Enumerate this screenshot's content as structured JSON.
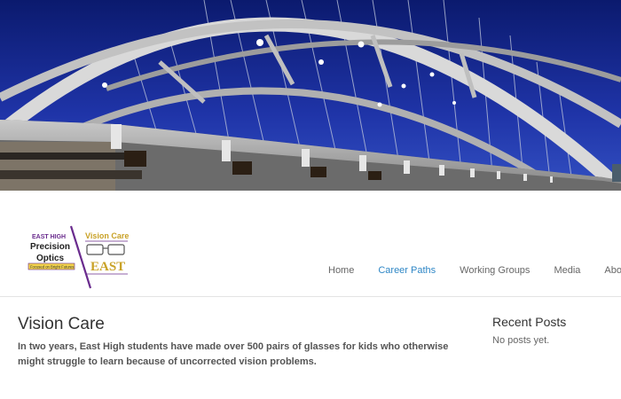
{
  "hero": {
    "image": "illuminated-arch-bridge-night-sky"
  },
  "logo": {
    "left_line1": "EAST HIGH",
    "left_line2": "Precision",
    "left_line3": "Optics",
    "tagline": "Focused on Bright Futures",
    "right_line1": "Vision Care",
    "right_line2": "EAST"
  },
  "nav": {
    "items": [
      {
        "label": "Home",
        "active": false
      },
      {
        "label": "Career Paths",
        "active": true
      },
      {
        "label": "Working Groups",
        "active": false
      },
      {
        "label": "Media",
        "active": false
      },
      {
        "label": "About ST",
        "active": false
      }
    ]
  },
  "main": {
    "title": "Vision Care",
    "intro": "In two years, East High students have made over 500 pairs of glasses for kids who otherwise might struggle to learn because of uncorrected vision problems."
  },
  "sidebar": {
    "title": "Recent Posts",
    "empty": "No posts yet."
  },
  "colors": {
    "accent": "#2f87c6",
    "logo_purple": "#6a2c8e",
    "logo_gold": "#c9a227",
    "sky": "#1d2a8c"
  }
}
